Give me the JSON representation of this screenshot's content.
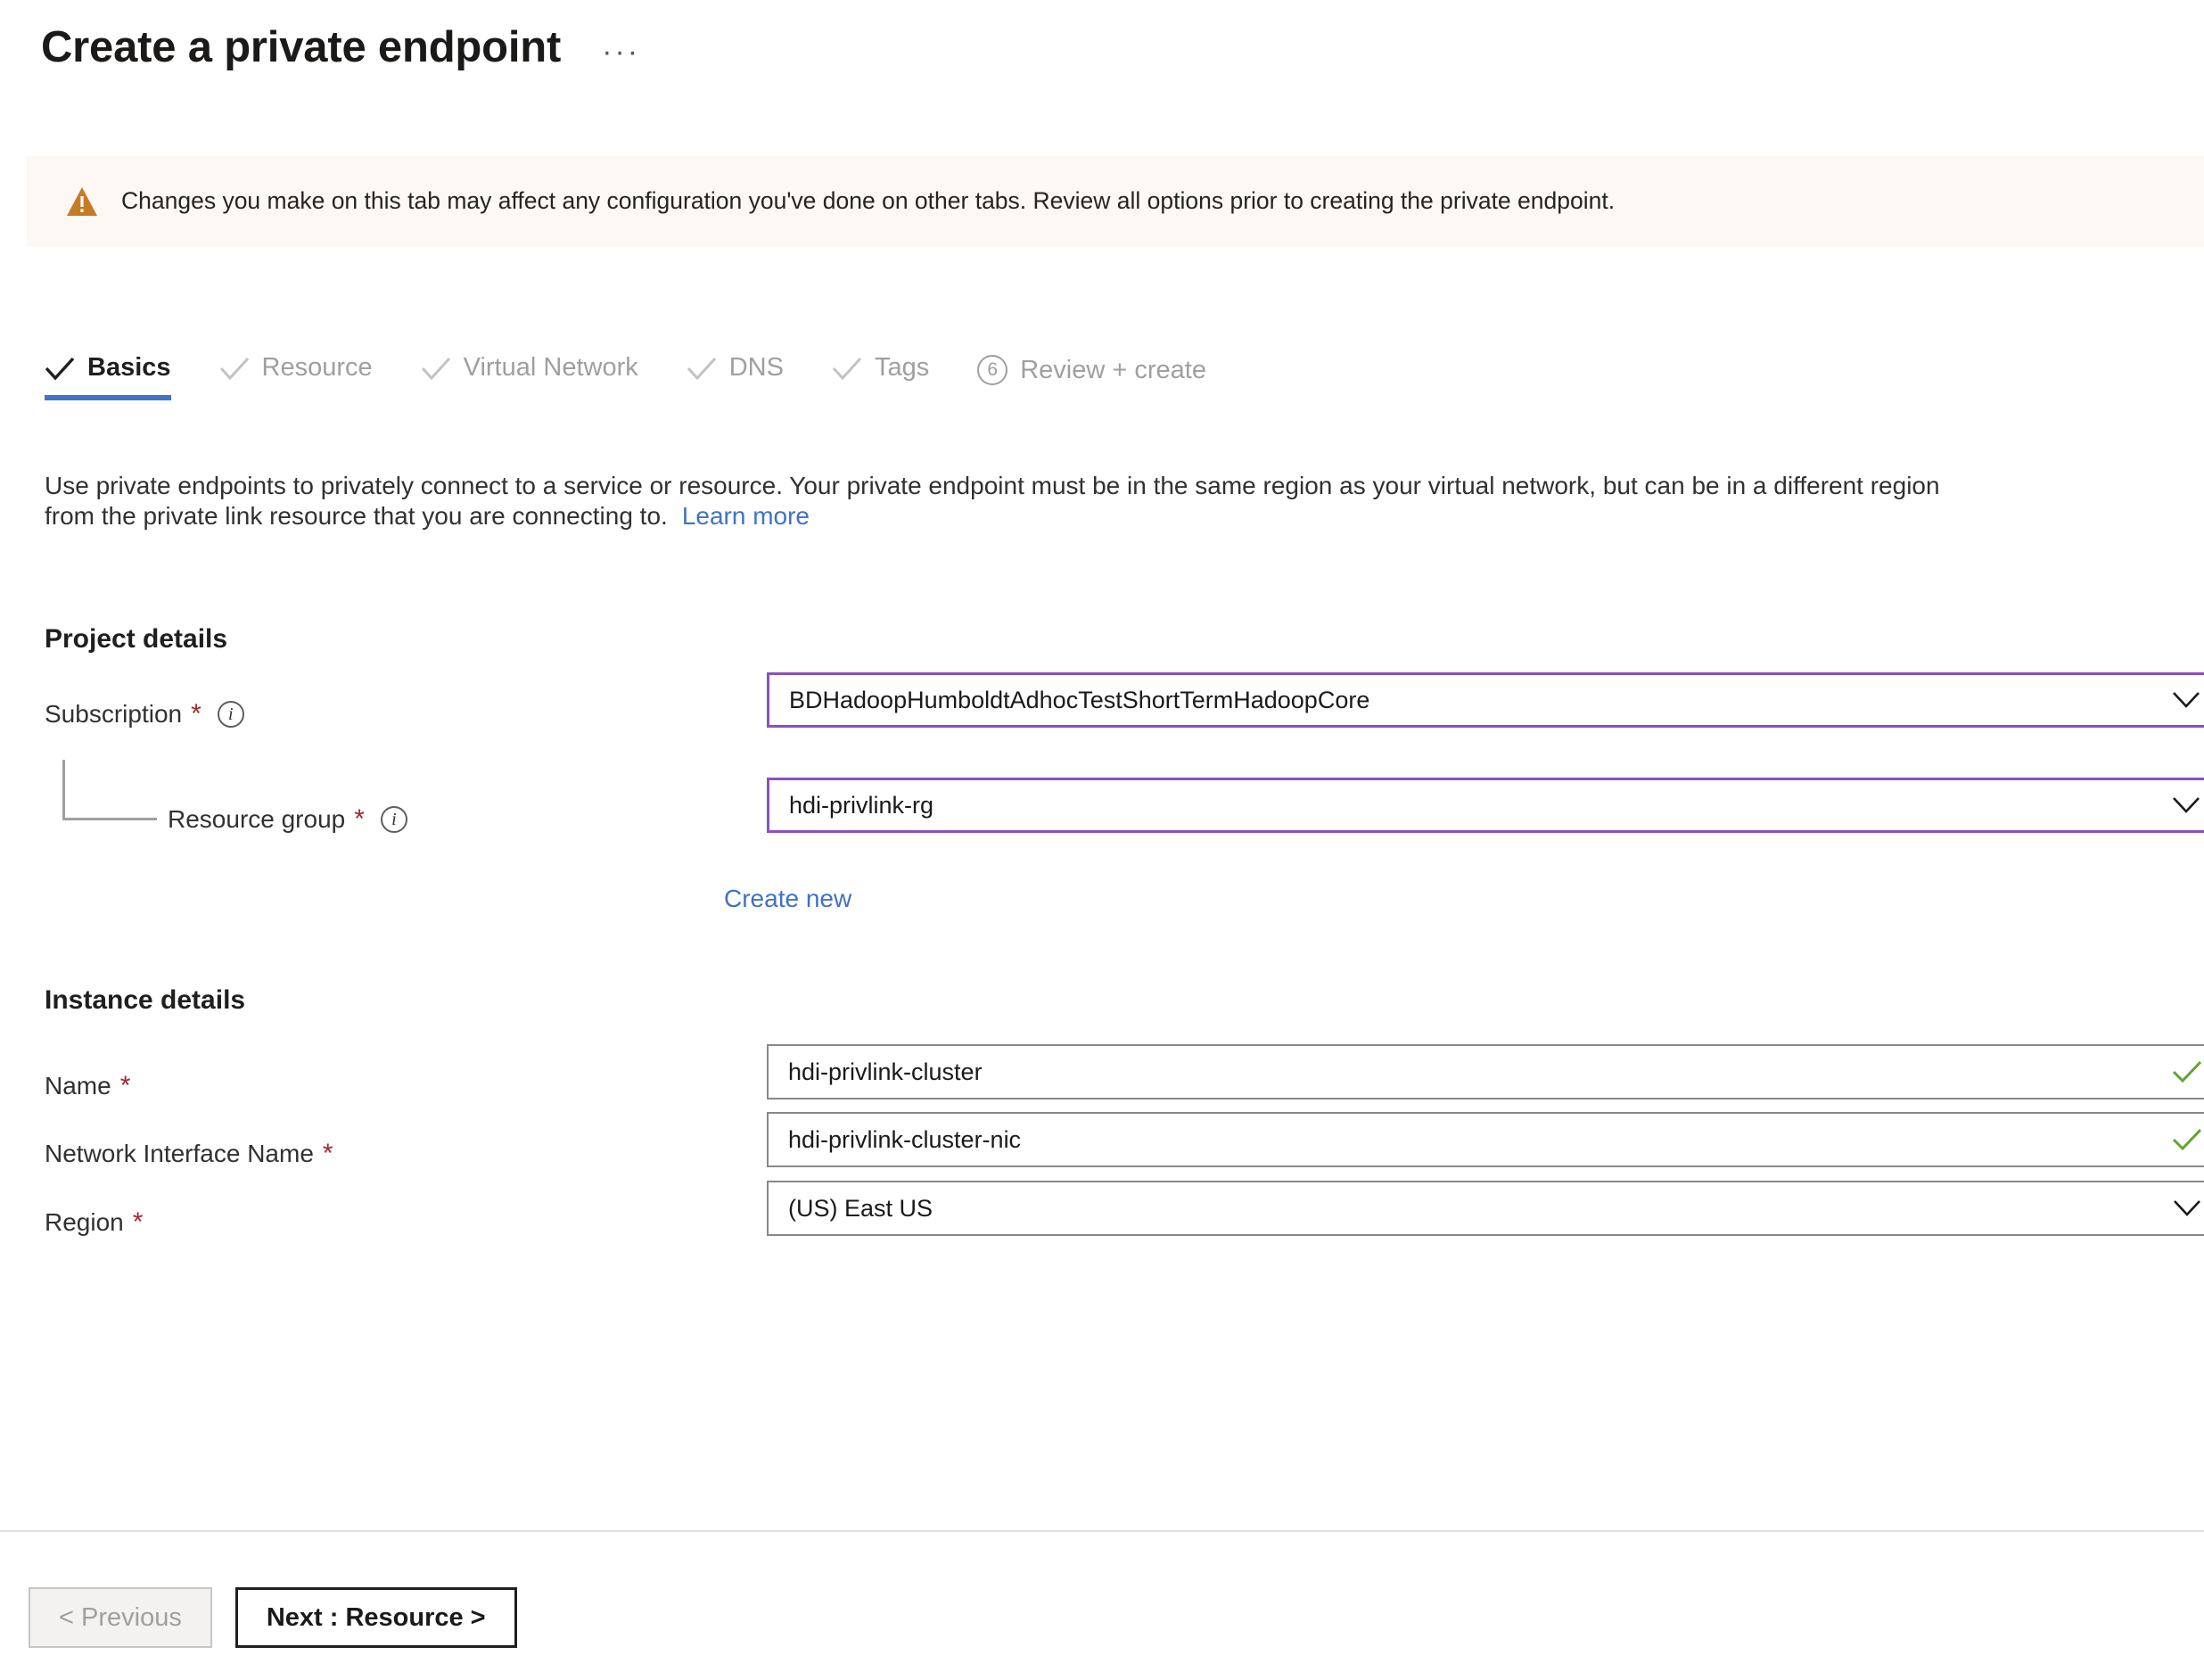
{
  "header": {
    "title": "Create a private endpoint",
    "ellipsis": "···"
  },
  "banner": {
    "icon": "warning-triangle-icon",
    "text": "Changes you make on this tab may affect any configuration you've done on other tabs. Review all options prior to creating the private endpoint.",
    "background_color": "#fdf8f4",
    "icon_color": "#c77b26"
  },
  "tabs": [
    {
      "label": "Basics",
      "state": "active",
      "marker": "check"
    },
    {
      "label": "Resource",
      "state": "completed",
      "marker": "check"
    },
    {
      "label": "Virtual Network",
      "state": "completed",
      "marker": "check"
    },
    {
      "label": "DNS",
      "state": "completed",
      "marker": "check"
    },
    {
      "label": "Tags",
      "state": "completed",
      "marker": "check"
    },
    {
      "label": "Review + create",
      "state": "pending",
      "marker": "number",
      "number": "6"
    }
  ],
  "description": {
    "text": "Use private endpoints to privately connect to a service or resource. Your private endpoint must be in the same region as your virtual network, but can be in a different region from the private link resource that you are connecting to.",
    "link_label": "Learn more"
  },
  "project_details": {
    "section_title": "Project details",
    "subscription": {
      "label": "Subscription",
      "required": "*",
      "info": "i",
      "value": "BDHadoopHumboldtAdhocTestShortTermHadoopCore",
      "control": "dropdown"
    },
    "resource_group": {
      "label": "Resource group",
      "required": "*",
      "info": "i",
      "value": "hdi-privlink-rg",
      "control": "dropdown",
      "create_new_label": "Create new"
    }
  },
  "instance_details": {
    "section_title": "Instance details",
    "name": {
      "label": "Name",
      "required": "*",
      "value": "hdi-privlink-cluster",
      "control": "textbox",
      "validation": "valid"
    },
    "network_interface_name": {
      "label": "Network Interface Name",
      "required": "*",
      "value": "hdi-privlink-cluster-nic",
      "control": "textbox",
      "validation": "valid"
    },
    "region": {
      "label": "Region",
      "required": "*",
      "value": "(US) East US",
      "control": "dropdown"
    }
  },
  "footer": {
    "previous_label": "< Previous",
    "previous_disabled": true,
    "next_label": "Next : Resource >"
  },
  "colors": {
    "accent_blue": "#3f72c4",
    "focus_purple": "#8c4fbf",
    "valid_green": "#5ca72e",
    "required_red": "#a4262c"
  }
}
